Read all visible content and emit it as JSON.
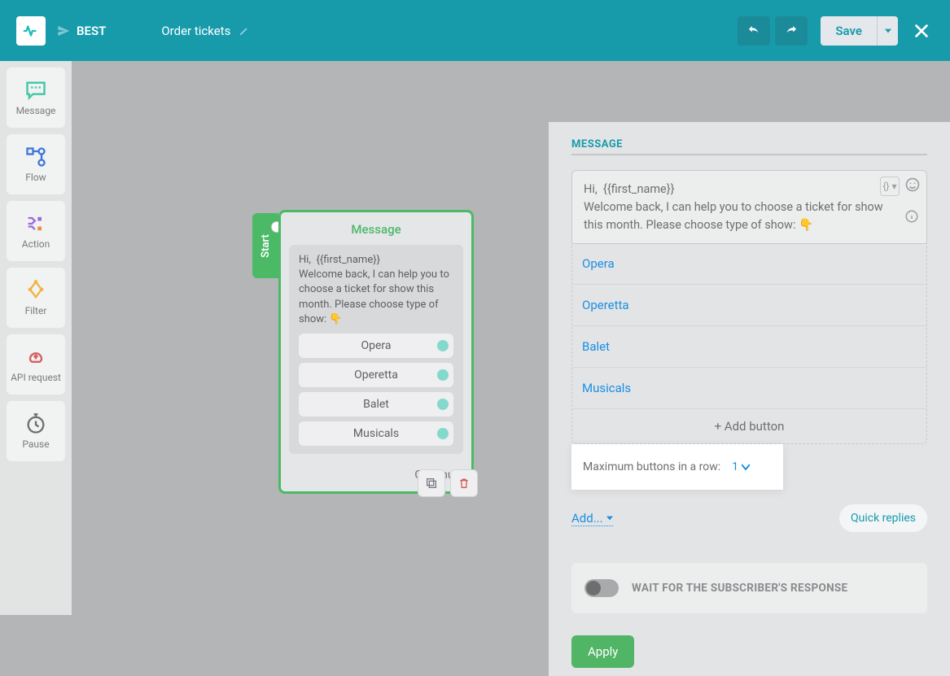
{
  "header": {
    "best_label": "BEST",
    "title": "Order tickets",
    "save_label": "Save"
  },
  "sidebar": {
    "items": [
      {
        "label": "Message"
      },
      {
        "label": "Flow"
      },
      {
        "label": "Action"
      },
      {
        "label": "Filter"
      },
      {
        "label": "API request"
      },
      {
        "label": "Pause"
      }
    ]
  },
  "node": {
    "title": "Message",
    "start_label": "Start",
    "text": "Hi,  {{first_name}}\nWelcome back, I can help you to choose a ticket for show this month. Please choose type of show: 👇",
    "options": [
      "Opera",
      "Operetta",
      "Balet",
      "Musicals"
    ],
    "continue_label": "Continue"
  },
  "panel": {
    "section_title": "MESSAGE",
    "message_text": "Hi,  {{first_name}}\nWelcome back, I can help you to choose a ticket for show this month. Please choose type of show: 👇",
    "buttons": [
      "Opera",
      "Operetta",
      "Balet",
      "Musicals"
    ],
    "add_button_label": "+ Add button",
    "max_row_label": "Maximum buttons in a row:",
    "max_row_value": "1",
    "add_label": "Add...",
    "quick_replies_label": "Quick replies",
    "wait_label": "WAIT FOR THE SUBSCRIBER'S RESPONSE",
    "apply_label": "Apply"
  }
}
